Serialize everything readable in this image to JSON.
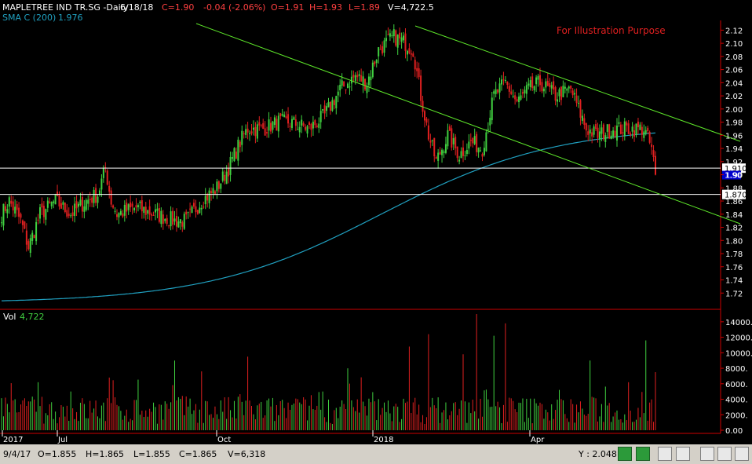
{
  "header": {
    "symbol": "MAPLETREE IND TR.SG -Daily",
    "date": "6/18/18",
    "close": "C=1.90",
    "change": "-0.04 (-2.06%)",
    "open": "O=1.91",
    "high": "H=1.93",
    "low": "L=1.89",
    "volume": "V=4,722.5",
    "sma_label": "SMA C (200)",
    "sma_value": "1.976",
    "note": "For Illustration Purpose"
  },
  "volume_panel": {
    "label": "Vol",
    "value": "4,722"
  },
  "status": {
    "date": "9/4/17",
    "open": "O=1.855",
    "high": "H=1.865",
    "low": "L=1.855",
    "close": "C=1.865",
    "volume": "V=6,318",
    "cursor_y": "Y : 2.048"
  },
  "colors": {
    "up": "#40d040",
    "down": "#e02020",
    "sma": "#20a0c0",
    "trendline": "#5ee82a",
    "axis": "#cc0000",
    "hline": "#ffffff",
    "grid": "#444444"
  },
  "chart_data": {
    "type": "candlestick",
    "price_axis": {
      "ylim": [
        1.7,
        2.13
      ],
      "ticks": [
        "1.72",
        "1.74",
        "1.76",
        "1.78",
        "1.80",
        "1.82",
        "1.84",
        "1.86",
        "1.88",
        "1.90",
        "1.92",
        "1.94",
        "1.96",
        "1.98",
        "2.00",
        "2.02",
        "2.04",
        "2.06",
        "2.08",
        "2.10",
        "2.12"
      ]
    },
    "volume_axis": {
      "ylim": [
        0,
        15000
      ],
      "ticks": [
        "0.00",
        "2000.",
        "4000.",
        "6000.",
        "8000.",
        "10000.",
        "12000.",
        "14000."
      ]
    },
    "x_labels": [
      "2017",
      "Jul",
      "Oct",
      "2018",
      "Apr"
    ],
    "horizontal_lines": [
      {
        "value": 1.91,
        "label": "1.910"
      },
      {
        "value": 1.87,
        "label": "1.870"
      }
    ],
    "last_price_label": "1.90",
    "keyframes": [
      {
        "t": 0,
        "v": 1.84
      },
      {
        "t": 4,
        "v": 1.86
      },
      {
        "t": 10,
        "v": 1.83
      },
      {
        "t": 14,
        "v": 1.79
      },
      {
        "t": 20,
        "v": 1.84
      },
      {
        "t": 28,
        "v": 1.86
      },
      {
        "t": 36,
        "v": 1.84
      },
      {
        "t": 44,
        "v": 1.86
      },
      {
        "t": 50,
        "v": 1.87
      },
      {
        "t": 54,
        "v": 1.91
      },
      {
        "t": 57,
        "v": 1.86
      },
      {
        "t": 60,
        "v": 1.84
      },
      {
        "t": 70,
        "v": 1.85
      },
      {
        "t": 80,
        "v": 1.84
      },
      {
        "t": 90,
        "v": 1.83
      },
      {
        "t": 96,
        "v": 1.83
      },
      {
        "t": 104,
        "v": 1.86
      },
      {
        "t": 112,
        "v": 1.88
      },
      {
        "t": 118,
        "v": 1.91
      },
      {
        "t": 124,
        "v": 1.95
      },
      {
        "t": 128,
        "v": 1.97
      },
      {
        "t": 136,
        "v": 1.97
      },
      {
        "t": 144,
        "v": 1.98
      },
      {
        "t": 150,
        "v": 1.98
      },
      {
        "t": 160,
        "v": 1.97
      },
      {
        "t": 168,
        "v": 1.99
      },
      {
        "t": 176,
        "v": 2.03
      },
      {
        "t": 184,
        "v": 2.05
      },
      {
        "t": 190,
        "v": 2.04
      },
      {
        "t": 196,
        "v": 2.09
      },
      {
        "t": 204,
        "v": 2.11
      },
      {
        "t": 210,
        "v": 2.1
      },
      {
        "t": 214,
        "v": 2.09
      },
      {
        "t": 218,
        "v": 2.02
      },
      {
        "t": 222,
        "v": 1.96
      },
      {
        "t": 226,
        "v": 1.92
      },
      {
        "t": 232,
        "v": 1.96
      },
      {
        "t": 238,
        "v": 1.93
      },
      {
        "t": 244,
        "v": 1.95
      },
      {
        "t": 250,
        "v": 1.94
      },
      {
        "t": 256,
        "v": 2.02
      },
      {
        "t": 262,
        "v": 2.04
      },
      {
        "t": 268,
        "v": 2.01
      },
      {
        "t": 274,
        "v": 2.03
      },
      {
        "t": 280,
        "v": 2.04
      },
      {
        "t": 288,
        "v": 2.02
      },
      {
        "t": 296,
        "v": 2.03
      },
      {
        "t": 304,
        "v": 1.97
      },
      {
        "t": 310,
        "v": 1.96
      },
      {
        "t": 318,
        "v": 1.97
      },
      {
        "t": 326,
        "v": 1.97
      },
      {
        "t": 334,
        "v": 1.97
      },
      {
        "t": 338,
        "v": 1.94
      },
      {
        "t": 340,
        "v": 1.9
      }
    ],
    "volume_spikes": [
      {
        "t": 19,
        "v": 6200
      },
      {
        "t": 36,
        "v": 5000
      },
      {
        "t": 56,
        "v": 6800
      },
      {
        "t": 90,
        "v": 9000
      },
      {
        "t": 104,
        "v": 7600
      },
      {
        "t": 128,
        "v": 9500
      },
      {
        "t": 180,
        "v": 8000
      },
      {
        "t": 212,
        "v": 10800
      },
      {
        "t": 222,
        "v": 12400
      },
      {
        "t": 240,
        "v": 9800
      },
      {
        "t": 247,
        "v": 15000
      },
      {
        "t": 256,
        "v": 12200
      },
      {
        "t": 262,
        "v": 13800
      },
      {
        "t": 306,
        "v": 9000
      },
      {
        "t": 335,
        "v": 11600
      },
      {
        "t": 340,
        "v": 7500
      }
    ]
  }
}
